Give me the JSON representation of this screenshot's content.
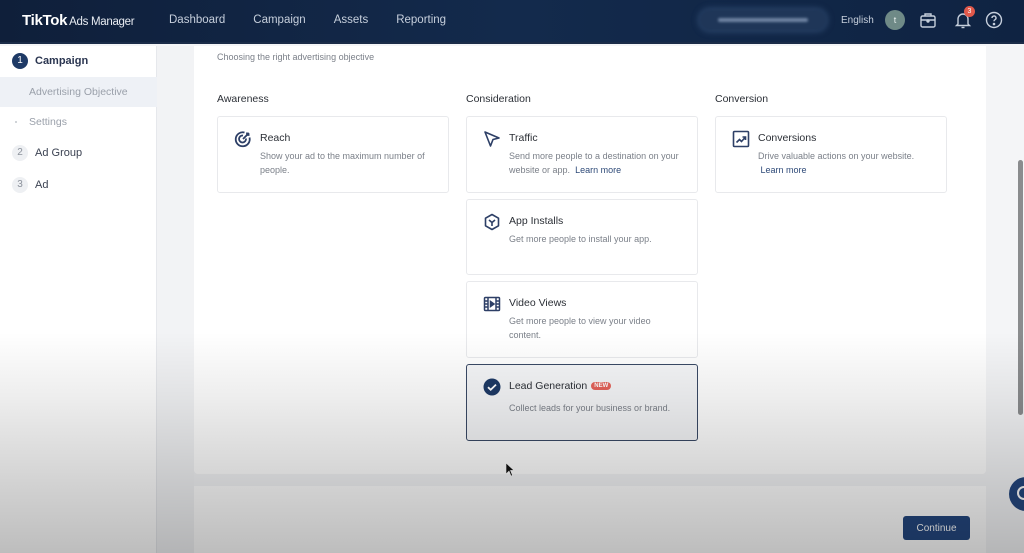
{
  "topbar": {
    "logo": "TikTok",
    "logo_sub": "Ads Manager",
    "nav": [
      "Dashboard",
      "Campaign",
      "Assets",
      "Reporting"
    ],
    "language": "English",
    "avatar_initial": "t",
    "notification_count": "3",
    "icons": [
      "briefcase-icon",
      "bell-icon",
      "help-icon"
    ]
  },
  "sidebar": {
    "steps": [
      {
        "num": "1",
        "label": "Campaign",
        "state": "active"
      },
      {
        "num": "2",
        "label": "Ad Group",
        "state": "inactive"
      },
      {
        "num": "3",
        "label": "Ad",
        "state": "inactive"
      }
    ],
    "substeps": [
      {
        "label": "Advertising Objective",
        "state": "active"
      },
      {
        "label": "Settings",
        "state": "inactive"
      }
    ]
  },
  "main": {
    "subtitle": "Choosing the right advertising objective",
    "columns": [
      {
        "title": "Awareness",
        "cards": [
          {
            "icon": "target-icon",
            "title": "Reach",
            "desc": "Show your ad to the maximum number of people."
          }
        ]
      },
      {
        "title": "Consideration",
        "cards": [
          {
            "icon": "cursor-arrow-icon",
            "title": "Traffic",
            "desc": "Send more people to a destination on your website or app.",
            "link": "Learn more"
          },
          {
            "icon": "app-cube-icon",
            "title": "App Installs",
            "desc": "Get more people to install your app."
          },
          {
            "icon": "video-film-icon",
            "title": "Video Views",
            "desc": "Get more people to view your video content."
          },
          {
            "icon": "check-circle-icon",
            "title": "Lead Generation",
            "badge": "NEW",
            "desc": "Collect leads for your business or brand.",
            "selected": true
          }
        ]
      },
      {
        "title": "Conversion",
        "cards": [
          {
            "icon": "trend-up-icon",
            "title": "Conversions",
            "desc": "Drive valuable actions on your website.",
            "link": "Learn more"
          }
        ]
      }
    ]
  },
  "footer": {
    "continue_label": "Continue"
  }
}
